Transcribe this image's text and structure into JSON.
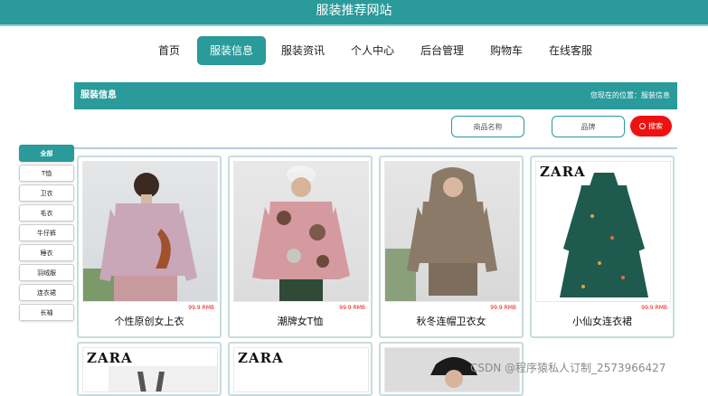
{
  "app": {
    "title": "服装推荐网站"
  },
  "nav": {
    "items": [
      {
        "label": "首页"
      },
      {
        "label": "服装信息",
        "active": true
      },
      {
        "label": "服装资讯"
      },
      {
        "label": "个人中心"
      },
      {
        "label": "后台管理"
      },
      {
        "label": "购物车"
      },
      {
        "label": "在线客服"
      }
    ]
  },
  "section": {
    "title": "服装信息",
    "location": "您现在的位置：服装信息"
  },
  "search": {
    "product_placeholder": "商品名称",
    "brand_placeholder": "品牌",
    "button_label": "搜索"
  },
  "categories": [
    "全部",
    "T恤",
    "卫衣",
    "毛衣",
    "牛仔裤",
    "睡衣",
    "羽绒服",
    "连衣裙",
    "长袖"
  ],
  "products": [
    {
      "name": "个性原创女上衣",
      "price": "99.9 RMB"
    },
    {
      "name": "潮牌女T恤",
      "price": "99.9 RMB"
    },
    {
      "name": "秋冬连帽卫衣女",
      "price": "99.9 RMB"
    },
    {
      "name": "小仙女连衣裙",
      "price": "99.9 RMB"
    }
  ],
  "watermark": "CSDN @程序猿私人订制_2573966427",
  "colors": {
    "primary": "#2a9a9a",
    "search_button": "#ee1111",
    "price": "#e11111"
  }
}
